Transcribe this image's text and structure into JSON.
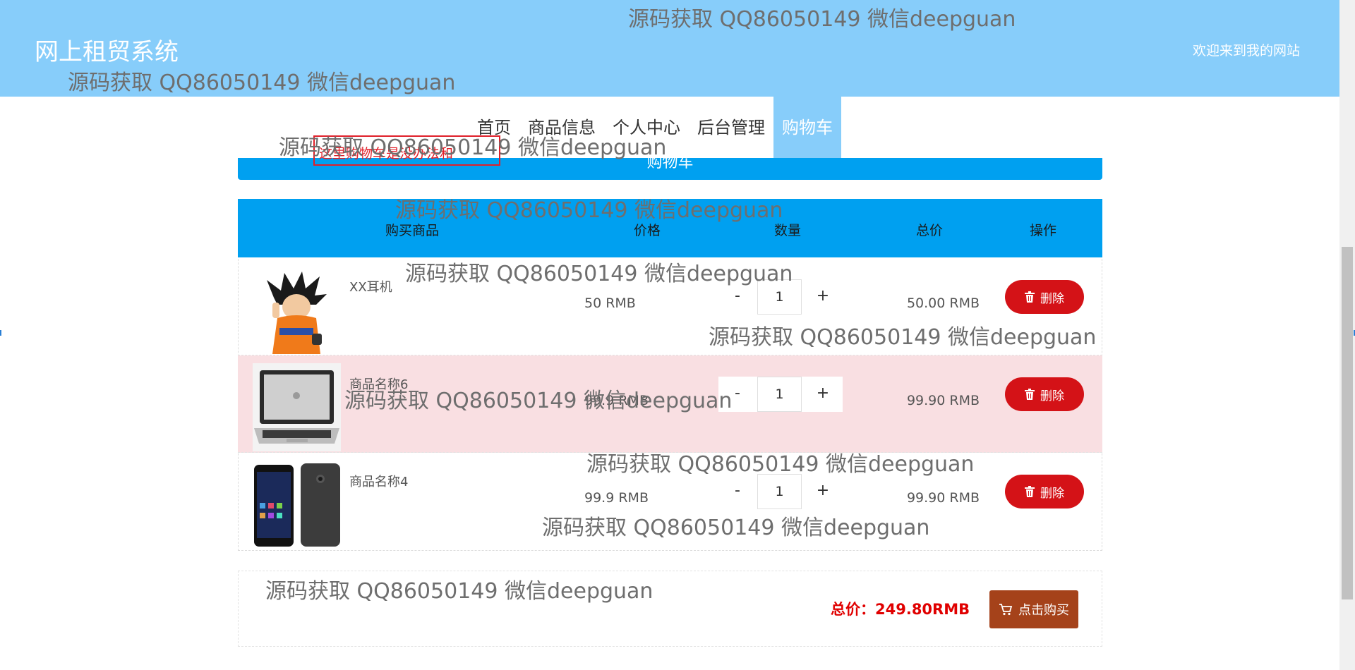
{
  "header": {
    "title": "网上租贸系统",
    "welcome": "欢迎来到我的网站"
  },
  "nav": [
    {
      "label": "首页",
      "active": false
    },
    {
      "label": "商品信息",
      "active": false
    },
    {
      "label": "个人中心",
      "active": false
    },
    {
      "label": "后台管理",
      "active": false
    },
    {
      "label": "购物车",
      "active": true
    }
  ],
  "banner": {
    "title": "购物车"
  },
  "annotation": "这里购物车是没办法和",
  "table": {
    "headers": [
      "购买商品",
      "价格",
      "数量",
      "总价",
      "操作"
    ],
    "rows": [
      {
        "name": "XX耳机",
        "price": "50 RMB",
        "qty": "1",
        "total": "50.00 RMB",
        "delete": "删除",
        "highlight": false,
        "image": "goku-figure"
      },
      {
        "name": "商品名称6",
        "price": "99.9 RMB",
        "qty": "1",
        "total": "99.90 RMB",
        "delete": "删除",
        "highlight": true,
        "image": "laptop"
      },
      {
        "name": "商品名称4",
        "price": "99.9 RMB",
        "qty": "1",
        "total": "99.90 RMB",
        "delete": "删除",
        "highlight": false,
        "image": "smartphones"
      }
    ],
    "stepper": {
      "minus": "-",
      "plus": "+"
    }
  },
  "summary": {
    "total": "总价：249.80RMB",
    "buy": "点击购买"
  },
  "watermark": "源码获取 QQ86050149 微信deepguan",
  "colors": {
    "header": "#87cdfa",
    "banner": "#00a0f0",
    "delete": "#d41217",
    "buy": "#a5421a",
    "total": "#e00000"
  },
  "icons": {
    "delete": "trash-icon",
    "buy": "cart-icon"
  }
}
